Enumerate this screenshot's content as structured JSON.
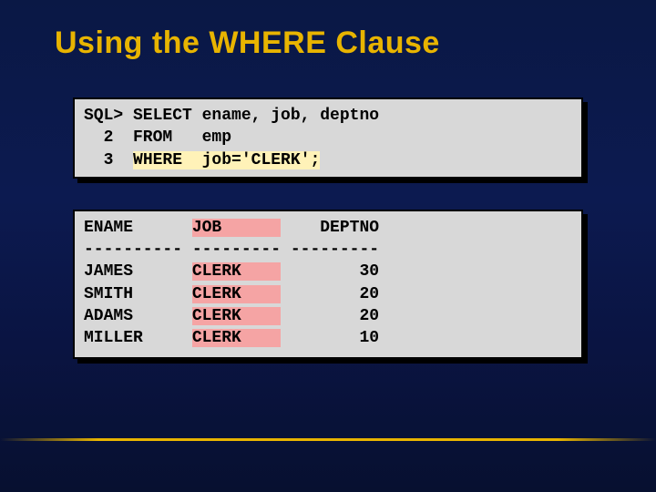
{
  "title": "Using the WHERE Clause",
  "query": {
    "l1a": "SQL> SELECT ename, job, deptno",
    "l2a": "  2  FROM   emp",
    "l3a": "  3  ",
    "l3b": "WHERE  job='CLERK';"
  },
  "result": {
    "h1": "ENAME      ",
    "h2": "JOB      ",
    "h3": "    DEPTNO",
    "sep": "---------- --------- ---------",
    "r1c1": "JAMES      ",
    "r1c2": "CLERK    ",
    "r1c3": "        30",
    "r2c1": "SMITH      ",
    "r2c2": "CLERK    ",
    "r2c3": "        20",
    "r3c1": "ADAMS      ",
    "r3c2": "CLERK    ",
    "r3c3": "        20",
    "r4c1": "MILLER     ",
    "r4c2": "CLERK    ",
    "r4c3": "        10"
  }
}
